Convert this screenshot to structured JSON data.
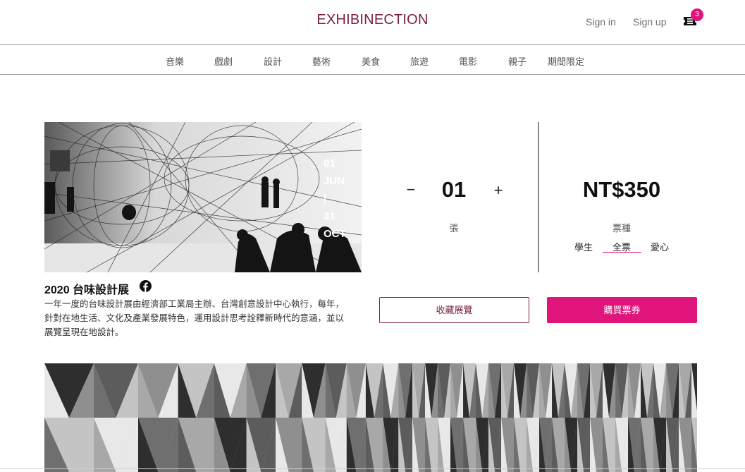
{
  "header": {
    "brand": "EXHIBINECTION",
    "sign_in": "Sign in",
    "sign_up": "Sign up",
    "cart_icon": "ticket-icon",
    "cart_count": "3"
  },
  "nav": {
    "items": [
      "音樂",
      "戲劇",
      "設計",
      "藝術",
      "美食",
      "旅遊",
      "電影",
      "親子",
      "期間限定"
    ]
  },
  "exhibition": {
    "date_lines": [
      "01",
      "JUN",
      "|",
      "31",
      "OCT"
    ],
    "title": "2020 台味設計展",
    "share_icon": "facebook-icon",
    "description": "一年一度的台味設計展由經濟部工業局主辦、台灣創意設計中心執行，每年，針對在地生活、文化及產業發展特色，運用設計思考詮釋新時代的意涵，並以展覽呈現在地設計。"
  },
  "quantity": {
    "minus": "−",
    "value": "01",
    "plus": "+",
    "unit": "張"
  },
  "pricing": {
    "price": "NT$350",
    "ticket_type_label": "票種",
    "options": [
      "學生",
      "全票",
      "愛心"
    ],
    "selected": "全票"
  },
  "actions": {
    "favorite": "收藏展覽",
    "buy": "購買票券"
  },
  "colors": {
    "brand": "#7a1f47",
    "accent": "#e0157c"
  }
}
